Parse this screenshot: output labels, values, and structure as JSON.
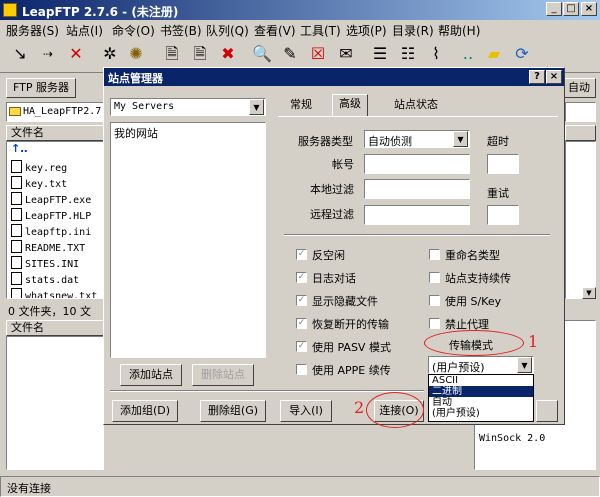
{
  "app": {
    "title": "LeapFTP 2.7.6 - (未注册)"
  },
  "menu": [
    "服务器(S)",
    "站点(I)",
    "命令(O)",
    "书签(B)",
    "队列(Q)",
    "查看(V)",
    "工具(T)",
    "选项(P)",
    "目录(R)",
    "帮助(H)"
  ],
  "left_panel": {
    "ftp_button": "FTP 服务器",
    "path": "HA_LeapFTP2.7.",
    "col_filename": "文件名",
    "files": [
      "key.reg",
      "key.txt",
      "LeapFTP.exe",
      "LeapFTP.HLP",
      "leapftp.ini",
      "README.TXT",
      "SITES.INI",
      "stats.dat",
      "whatsnew.txt"
    ],
    "summary": "0 文件夹，10 文",
    "bottom_col": "文件名"
  },
  "right_panel": {
    "auto_label": "自动",
    "winsock": "WinSock 2.0"
  },
  "status_bar": "没有连接",
  "dialog": {
    "title": "站点管理器",
    "help": "?",
    "close": "×",
    "servers_combo": "My Servers",
    "tree_item": "我的网站",
    "tabs": [
      "常规",
      "高级",
      "站点状态"
    ],
    "server_type_label": "服务器类型",
    "server_type_value": "自动侦测",
    "timeout_label": "超时",
    "account_label": "帐号",
    "local_filter_label": "本地过滤",
    "remote_filter_label": "远程过滤",
    "retry_label": "重试",
    "checks_left": [
      "反空闲",
      "日志对话",
      "显示隐藏文件",
      "恢复断开的传输",
      "使用 PASV 模式",
      "使用 APPE 续传"
    ],
    "checks_right": [
      "重命名类型",
      "站点支持续传",
      "使用 S/Key",
      "禁止代理"
    ],
    "transfer_mode_label": "传输模式",
    "transfer_mode_value": "(用户预设)",
    "transfer_options": [
      "ASCII",
      "二进制",
      "自动",
      "(用户预设)"
    ],
    "add_site": "添加站点",
    "delete_site": "删除站点",
    "add_group": "添加组(D)",
    "delete_group": "删除组(G)",
    "import": "导入(I)",
    "connect": "连接(O)",
    "annotation_1": "1",
    "annotation_2": "2"
  }
}
